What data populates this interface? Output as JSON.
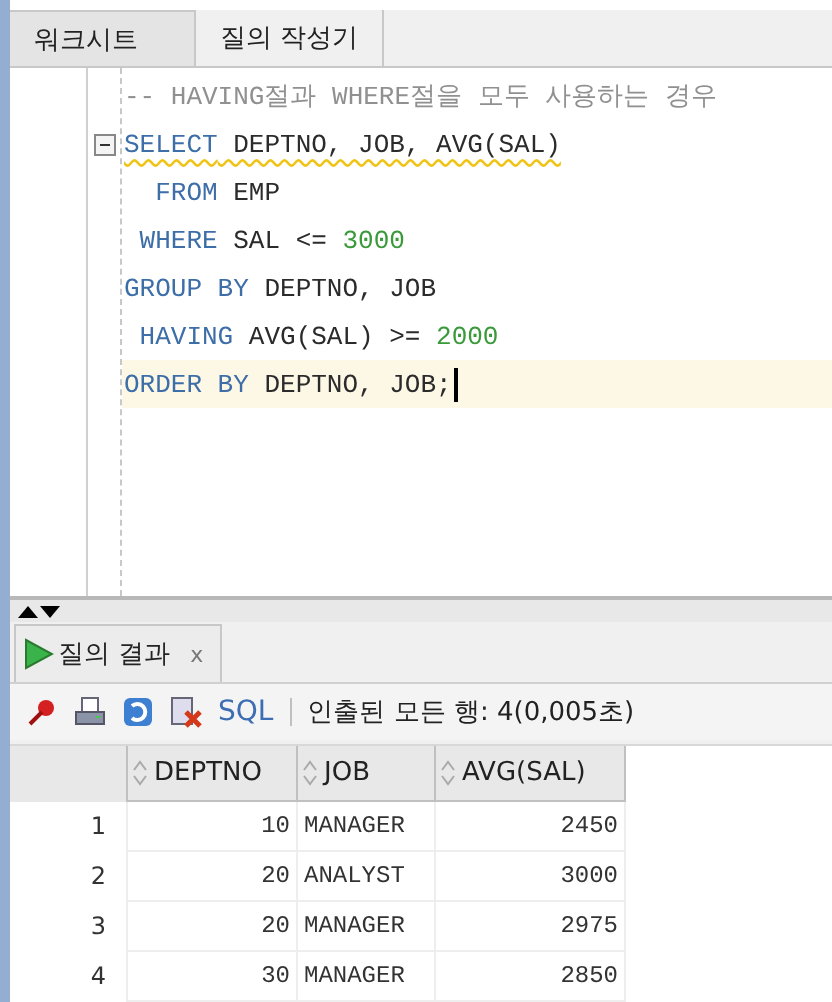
{
  "tabs": [
    {
      "label": "워크시트",
      "selected": true
    },
    {
      "label": "질의 작성기",
      "selected": false
    }
  ],
  "editor": {
    "lines": [
      {
        "fold": false,
        "warning": false,
        "current": false,
        "tokens": [
          {
            "kind": "comment",
            "text": "-- HAVING절과 WHERE절을 모두 사용하는 경우"
          }
        ]
      },
      {
        "fold": true,
        "warning": true,
        "current": false,
        "tokens": [
          {
            "kind": "keyword",
            "text": "SELECT"
          },
          {
            "kind": "plain",
            "text": " DEPTNO, JOB, AVG(SAL)"
          }
        ]
      },
      {
        "fold": false,
        "warning": false,
        "current": false,
        "tokens": [
          {
            "kind": "keyword",
            "text": "  FROM"
          },
          {
            "kind": "plain",
            "text": " EMP"
          }
        ]
      },
      {
        "fold": false,
        "warning": false,
        "current": false,
        "tokens": [
          {
            "kind": "keyword",
            "text": " WHERE"
          },
          {
            "kind": "plain",
            "text": " SAL <= "
          },
          {
            "kind": "number",
            "text": "3000"
          }
        ]
      },
      {
        "fold": false,
        "warning": false,
        "current": false,
        "tokens": [
          {
            "kind": "keyword",
            "text": "GROUP BY"
          },
          {
            "kind": "plain",
            "text": " DEPTNO, JOB"
          }
        ]
      },
      {
        "fold": false,
        "warning": false,
        "current": false,
        "tokens": [
          {
            "kind": "keyword",
            "text": " HAVING"
          },
          {
            "kind": "plain",
            "text": " AVG(SAL) >= "
          },
          {
            "kind": "number",
            "text": "2000"
          }
        ]
      },
      {
        "fold": false,
        "warning": false,
        "current": true,
        "tokens": [
          {
            "kind": "keyword",
            "text": "ORDER BY"
          },
          {
            "kind": "plain",
            "text": " DEPTNO, JOB;"
          }
        ]
      }
    ]
  },
  "results": {
    "tab": {
      "label": "질의 결과",
      "close": "x"
    },
    "toolbar": {
      "sql_link": "SQL",
      "status": "인출된 모든 행: 4(0,005초)"
    },
    "table": {
      "columns": [
        "DEPTNO",
        "JOB",
        "AVG(SAL)"
      ],
      "rows": [
        {
          "number": "1",
          "cells": [
            "10",
            "MANAGER",
            "2450"
          ]
        },
        {
          "number": "2",
          "cells": [
            "20",
            "ANALYST",
            "3000"
          ]
        },
        {
          "number": "3",
          "cells": [
            "20",
            "MANAGER",
            "2975"
          ]
        },
        {
          "number": "4",
          "cells": [
            "30",
            "MANAGER",
            "2850"
          ]
        }
      ]
    }
  }
}
